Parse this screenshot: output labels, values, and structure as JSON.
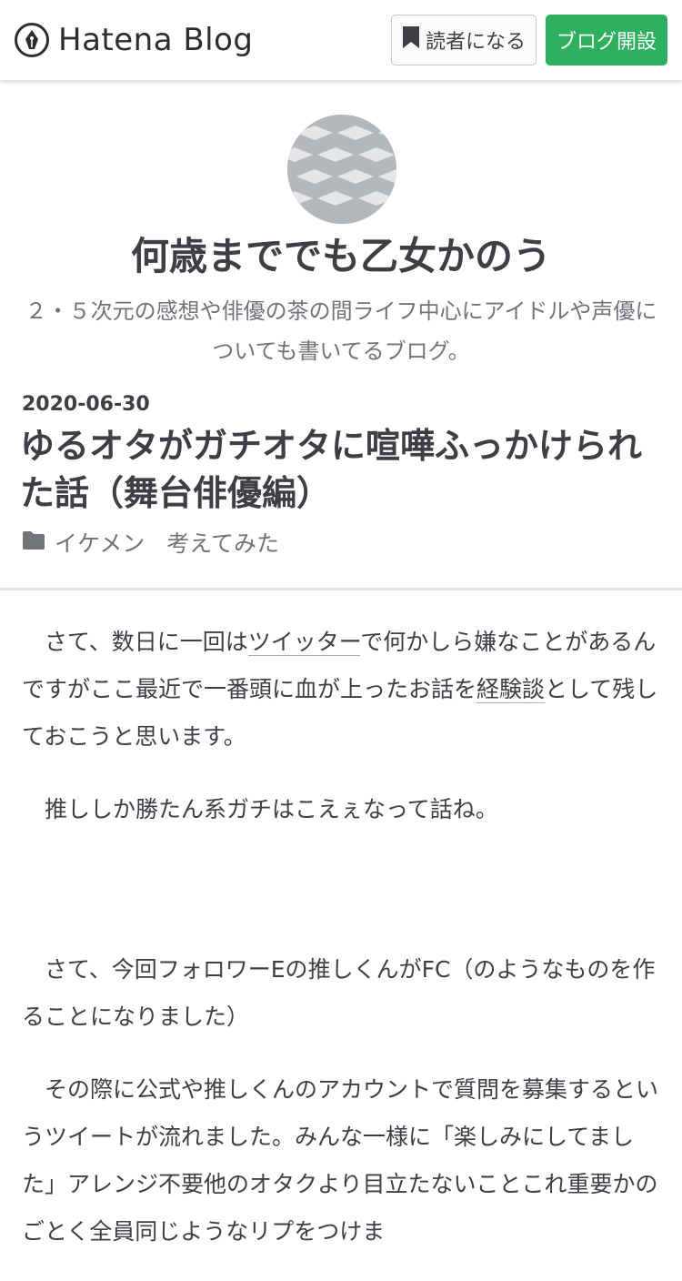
{
  "nav": {
    "brand": "Hatena Blog",
    "subscribe_label": "読者になる",
    "open_blog_label": "ブログ開設",
    "colors": {
      "open_blog_bg": "#2eb15e"
    },
    "icons": {
      "brand": "pen-nib-icon",
      "subscribe": "bookmark-icon"
    }
  },
  "blog": {
    "title": "何歳まででも乙女かのう",
    "description": "２・５次元の感想や俳優の茶の間ライフ中心にアイドルや声優についても書いてるブログ。"
  },
  "entry": {
    "date": "2020-06-30",
    "title": "ゆるオタがガチオタに喧嘩ふっかけられた話（舞台俳優編）",
    "categories": [
      "イケメン",
      "考えてみた"
    ],
    "category_icon": "folder-icon",
    "body": {
      "p1_a": "さて、数日に一回は",
      "p1_link1": "ツイッター",
      "p1_b": "で何かしら嫌なことがあるんですがここ最近で一番頭に血が上ったお話を",
      "p1_link2": "経験談",
      "p1_c": "として残しておこうと思います。",
      "p2": "推ししか勝たん系ガチはこえぇなって話ね。",
      "p3": "さて、今回フォロワーEの推しくんがFC（のようなものを作ることになりました）",
      "p4": "その際に公式や推しくんのアカウントで質問を募集するというツイートが流れました。みんな一様に「楽しみにしてました」アレンジ不要他のオタクより目立たないことこれ重要かのごとく全員同じようなリプをつけま"
    }
  }
}
